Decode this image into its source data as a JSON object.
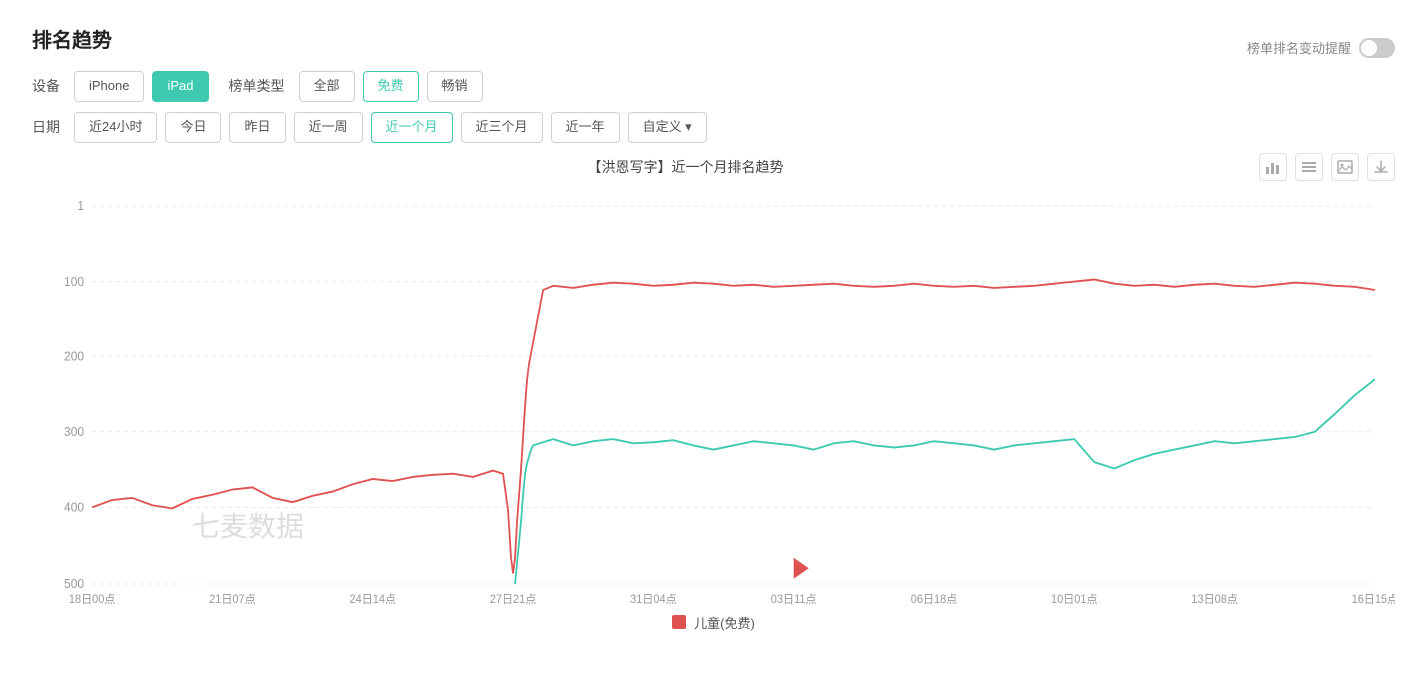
{
  "page": {
    "title": "排名趋势",
    "toggle_label": "榜单排名变动提醒"
  },
  "filters": {
    "device_label": "设备",
    "devices": [
      {
        "label": "iPhone",
        "active": false
      },
      {
        "label": "iPad",
        "active": true
      }
    ],
    "list_type_label": "榜单类型",
    "list_types": [
      {
        "label": "全部",
        "active": false
      },
      {
        "label": "免费",
        "active": true
      },
      {
        "label": "畅销",
        "active": false
      }
    ],
    "date_label": "日期",
    "dates": [
      {
        "label": "近24小时",
        "active": false
      },
      {
        "label": "今日",
        "active": false
      },
      {
        "label": "昨日",
        "active": false
      },
      {
        "label": "近一周",
        "active": false
      },
      {
        "label": "近一个月",
        "active": true
      },
      {
        "label": "近三个月",
        "active": false
      },
      {
        "label": "近一年",
        "active": false
      },
      {
        "label": "自定义 ▾",
        "active": false
      }
    ]
  },
  "chart": {
    "title": "【洪恩写字】近一个月排名趋势",
    "watermark": "七麦数据",
    "x_labels": [
      "18日00点",
      "21日07点",
      "24日14点",
      "27日21点",
      "31日04点",
      "03日11点",
      "06日18点",
      "10日01点",
      "13日08点",
      "16日15点"
    ],
    "y_labels": [
      "1",
      "100",
      "200",
      "300",
      "400",
      "500"
    ],
    "legend_label": "儿童(免费)"
  }
}
